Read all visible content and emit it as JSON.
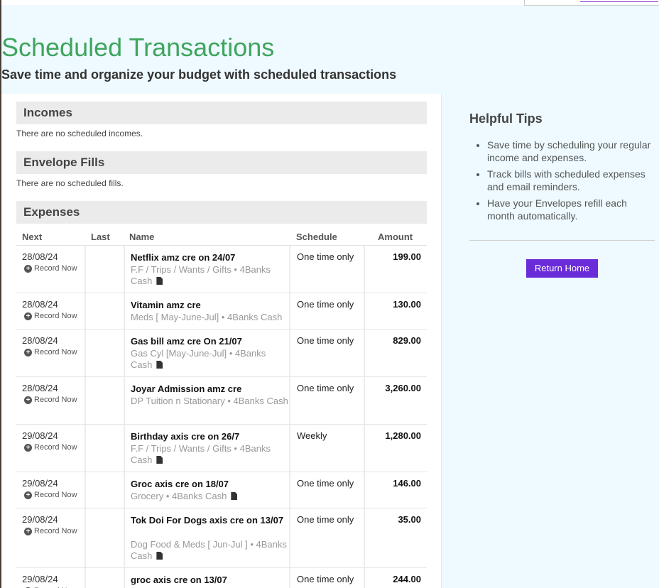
{
  "header": {
    "title": "Scheduled Transactions",
    "subtitle": "Save time and organize your budget with scheduled transactions"
  },
  "sections": {
    "incomes": {
      "title": "Incomes",
      "empty": "There are no scheduled incomes."
    },
    "fills": {
      "title": "Envelope Fills",
      "empty": "There are no scheduled fills."
    },
    "expenses": {
      "title": "Expenses"
    }
  },
  "table": {
    "headers": {
      "next": "Next",
      "last": "Last",
      "name": "Name",
      "schedule": "Schedule",
      "amount": "Amount"
    },
    "record_label": "Record Now",
    "rows": [
      {
        "next": "28/08/24",
        "name": "Netflix amz cre on 24/07",
        "category": "F.F / Trips / Wants / Gifts • 4Banks Cash",
        "schedule": "One time only",
        "amount": "199.00",
        "has_doc": true
      },
      {
        "next": "28/08/24",
        "name": "Vitamin amz cre",
        "category": "Meds [ May-June-Jul] • 4Banks Cash",
        "schedule": "One time only",
        "amount": "130.00",
        "has_doc": false
      },
      {
        "next": "28/08/24",
        "name": "Gas bill amz cre On 21/07",
        "category": "Gas Cyl [May-June-Jul] • 4Banks Cash",
        "schedule": "One time only",
        "amount": "829.00",
        "has_doc": true
      },
      {
        "next": "28/08/24",
        "name": "Joyar Admission amz cre",
        "category": "DP Tuition n Stationary • 4Banks Cash",
        "schedule": "One time only",
        "amount": "3,260.00",
        "has_doc": false
      },
      {
        "next": "29/08/24",
        "name": "Birthday axis cre on 26/7",
        "category": "F.F / Trips / Wants / Gifts • 4Banks Cash",
        "schedule": "Weekly",
        "amount": "1,280.00",
        "has_doc": true
      },
      {
        "next": "29/08/24",
        "name": "Groc axis cre on 18/07",
        "category": "Grocery • 4Banks Cash",
        "schedule": "One time only",
        "amount": "146.00",
        "has_doc": true
      },
      {
        "next": "29/08/24",
        "name": "Tok Doi For Dogs axis cre on 13/07",
        "category": "Dog Food & Meds [ Jun-Jul ] • 4Banks Cash",
        "schedule": "One time only",
        "amount": "35.00",
        "has_doc": true
      },
      {
        "next": "29/08/24",
        "name": "groc axis cre on 13/07",
        "category": "",
        "schedule": "One time only",
        "amount": "244.00",
        "has_doc": false
      }
    ]
  },
  "tips": {
    "title": "Helpful Tips",
    "items": [
      "Save time by scheduling your regular income and expenses.",
      "Track bills with scheduled expenses and email reminders.",
      "Have your Envelopes refill each month automatically."
    ],
    "button": "Return Home"
  }
}
